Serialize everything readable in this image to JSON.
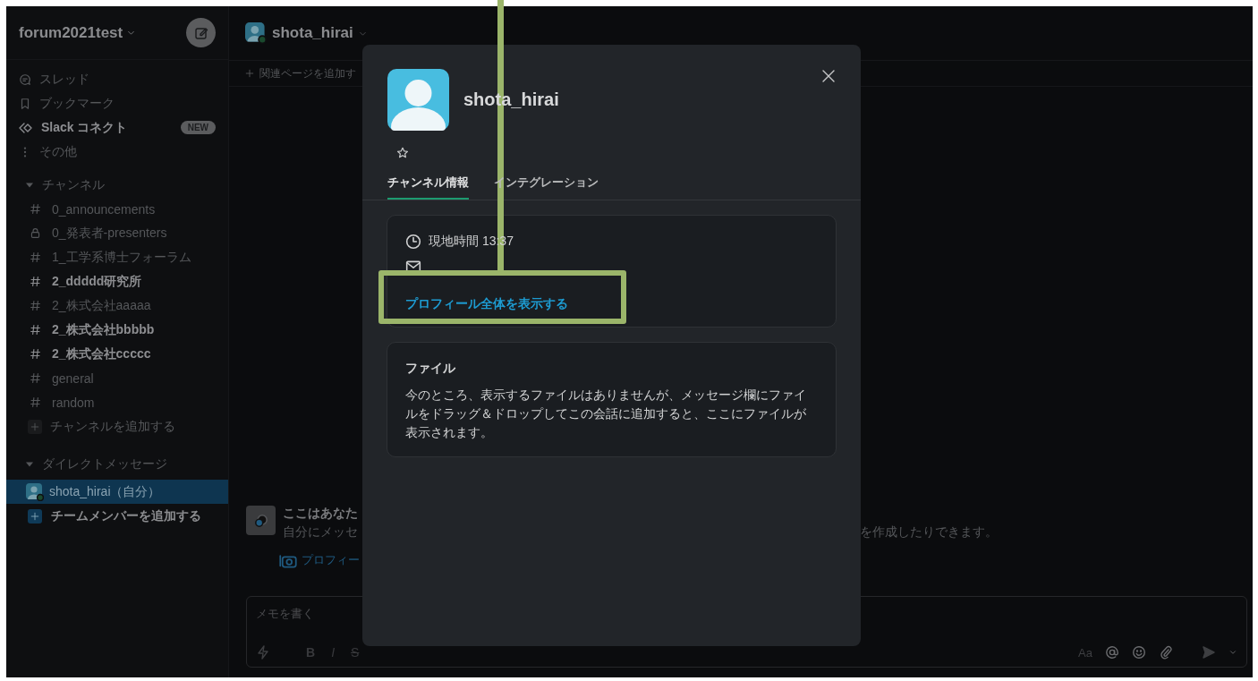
{
  "workspace": {
    "name": "forum2021test"
  },
  "sidebar": {
    "items": [
      {
        "kind": "threads",
        "label": "スレッド",
        "bold": false
      },
      {
        "kind": "bookmarks",
        "label": "ブックマーク",
        "bold": false
      },
      {
        "kind": "connect",
        "label": "Slack コネクト",
        "bold": true,
        "badge": "NEW"
      },
      {
        "kind": "more",
        "label": "その他",
        "bold": false
      }
    ],
    "channels_section": {
      "title": "チャンネル",
      "expanded": true
    },
    "channels": [
      {
        "kind": "public",
        "name": "0_announcements",
        "unread": false
      },
      {
        "kind": "private",
        "name": "0_発表者-presenters",
        "unread": false
      },
      {
        "kind": "public",
        "name": "1_工学系博士フォーラム",
        "unread": false
      },
      {
        "kind": "public",
        "name": "2_ddddd研究所",
        "unread": true
      },
      {
        "kind": "public",
        "name": "2_株式会社aaaaa",
        "unread": false
      },
      {
        "kind": "public",
        "name": "2_株式会社bbbbb",
        "unread": true
      },
      {
        "kind": "public",
        "name": "2_株式会社ccccc",
        "unread": true
      },
      {
        "kind": "public",
        "name": "general",
        "unread": false
      },
      {
        "kind": "public",
        "name": "random",
        "unread": false
      }
    ],
    "add_channel": "チャンネルを追加する",
    "dm_section": {
      "title": "ダイレクトメッセージ",
      "expanded": true
    },
    "dms": [
      {
        "name": "shota_hirai（自分）",
        "selected": true
      }
    ],
    "add_member": "チームメンバーを追加する"
  },
  "channel_header": {
    "name": "shota_hirai",
    "bookmark_action": "関連ページを追加す"
  },
  "intro": {
    "title": "ここはあなた",
    "line_start": "自分にメッセ",
    "line_end": "を作成したりできます。",
    "profile_link": "プロフィー"
  },
  "composer": {
    "placeholder": "メモを書く",
    "format_buttons": [
      {
        "kind": "bold",
        "label": "B"
      },
      {
        "kind": "italic",
        "label": "I"
      },
      {
        "kind": "strike",
        "label": "S"
      }
    ],
    "text_style": "Aa"
  },
  "modal": {
    "name": "shota_hirai",
    "starred": false,
    "tabs": [
      {
        "label": "チャンネル情報",
        "selected": true
      },
      {
        "label": "インテグレーション",
        "selected": false
      }
    ],
    "local_time": "現地時間 13:37",
    "profile_link": "プロフィール全体を表示する",
    "files": {
      "title": "ファイル",
      "body": "今のところ、表示するファイルはありませんが、メッセージ欄にファイルをドラッグ＆ドロップしてこの会話に追加すると、ここにファイルが表示されます。"
    }
  }
}
